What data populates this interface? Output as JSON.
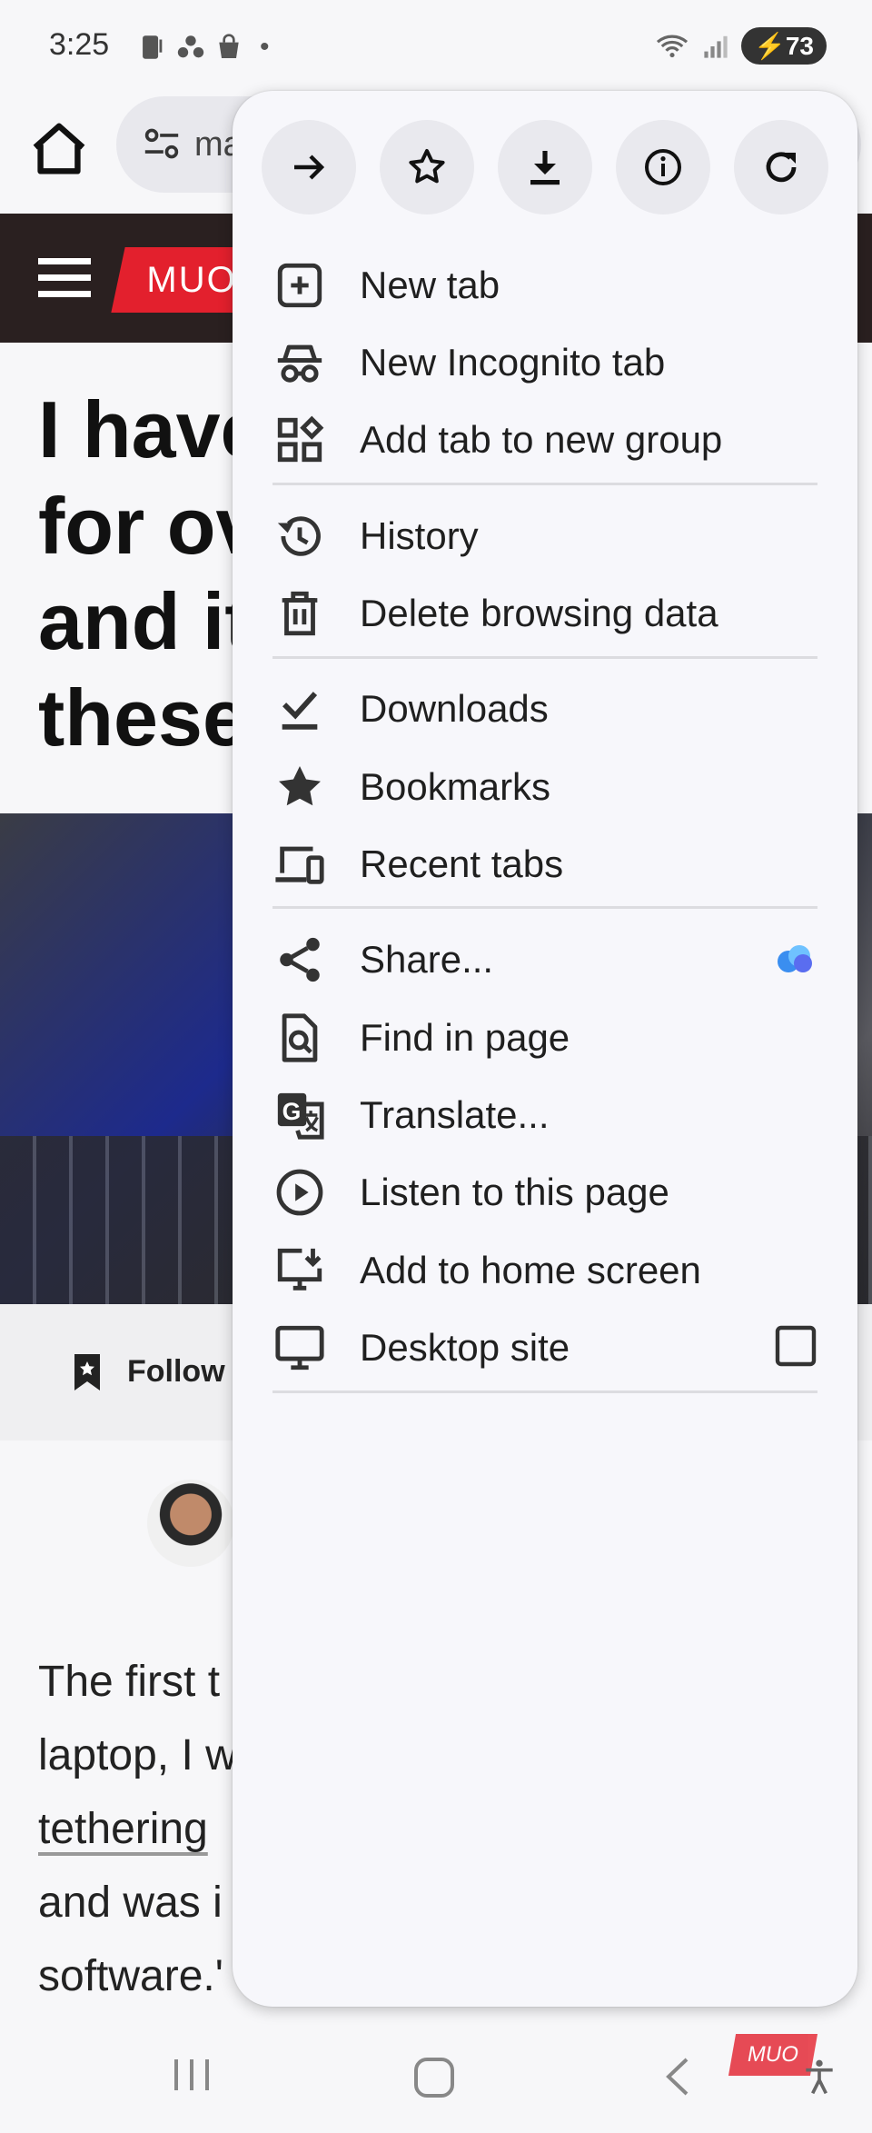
{
  "status_bar": {
    "time": "3:25",
    "battery": "73",
    "dot": "•"
  },
  "omnibox": {
    "text": "ma"
  },
  "site": {
    "logo": "MUO"
  },
  "article": {
    "headline_lines": [
      "I have",
      "for ov",
      "and it",
      "these"
    ],
    "follow_label": "Follow",
    "body_lines": [
      "The first t",
      "laptop, I w",
      "tethering",
      "and was i",
      "software.'"
    ]
  },
  "menu": {
    "actions": [
      {
        "icon": "forward-icon"
      },
      {
        "icon": "star-outline-icon"
      },
      {
        "icon": "download-icon"
      },
      {
        "icon": "info-icon"
      },
      {
        "icon": "reload-icon"
      }
    ],
    "items": [
      {
        "label": "New tab",
        "icon": "new-tab-icon"
      },
      {
        "label": "New Incognito tab",
        "icon": "incognito-icon"
      },
      {
        "label": "Add tab to new group",
        "icon": "tab-group-icon"
      },
      {
        "label": "History",
        "icon": "history-icon"
      },
      {
        "label": "Delete browsing data",
        "icon": "trash-icon"
      },
      {
        "label": "Downloads",
        "icon": "downloads-icon"
      },
      {
        "label": "Bookmarks",
        "icon": "bookmark-star-icon"
      },
      {
        "label": "Recent tabs",
        "icon": "devices-icon"
      },
      {
        "label": "Share...",
        "icon": "share-icon"
      },
      {
        "label": "Find in page",
        "icon": "find-in-page-icon"
      },
      {
        "label": "Translate...",
        "icon": "translate-icon"
      },
      {
        "label": "Listen to this page",
        "icon": "play-circle-icon"
      },
      {
        "label": "Add to home screen",
        "icon": "add-to-home-icon"
      },
      {
        "label": "Desktop site",
        "icon": "desktop-icon"
      }
    ],
    "desktop_site_checked": false
  },
  "nav": {
    "watermark": "MUO"
  },
  "colors": {
    "brand_red": "#e3202d",
    "menu_bg": "#f7f7fb",
    "action_bg": "#e9e9ee"
  }
}
